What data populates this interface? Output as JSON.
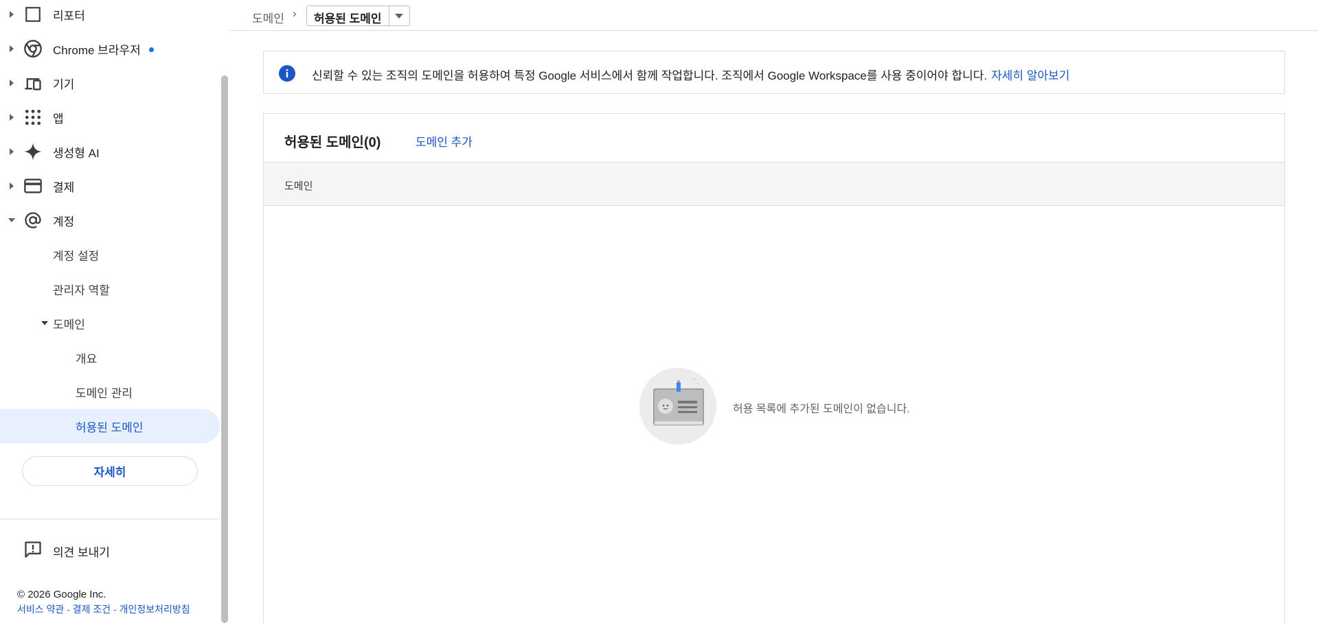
{
  "sidebar": {
    "items": [
      {
        "label": "리포터",
        "icon": "report-icon"
      },
      {
        "label": "Chrome 브라우저",
        "icon": "chrome-icon"
      },
      {
        "label": "기기",
        "icon": "devices-icon"
      },
      {
        "label": "앱",
        "icon": "apps-grid-icon"
      },
      {
        "label": "생성형 AI",
        "icon": "sparkle-icon"
      },
      {
        "label": "결제",
        "icon": "credit-card-icon"
      },
      {
        "label": "계정",
        "icon": "at-sign-icon"
      }
    ],
    "account_children": [
      "계정 설정",
      "관리자 역할"
    ],
    "domain_group": "도메인",
    "domain_children": [
      "개요",
      "도메인 관리",
      "허용된 도메인"
    ],
    "more_button": "자세히",
    "feedback": "의견 보내기",
    "copyright": "© 2026 Google Inc.",
    "footer_links": [
      "서비스 약관",
      "결제 조건",
      "개인정보처리방침"
    ],
    "footer_sep": " - "
  },
  "header": {
    "breadcrumb_root": "도메인",
    "breadcrumb_sep": "›",
    "current_select": "허용된 도메인"
  },
  "banner": {
    "text": "신뢰할 수 있는 조직의 도메인을 허용하여 특정 Google 서비스에서 함께 작업합니다. 조직에서 Google Workspace를 사용 중이어야 합니다.",
    "link": "자세히 알아보기"
  },
  "card": {
    "title": "허용된 도메인(0)",
    "add_link": "도메인 추가",
    "column_header": "도메인",
    "empty_text": "허용 목록에 추가된 도메인이 없습니다."
  },
  "colors": {
    "accent": "#1a73e8",
    "link": "#1a56c4",
    "selected_bg": "#e8f0fe"
  }
}
